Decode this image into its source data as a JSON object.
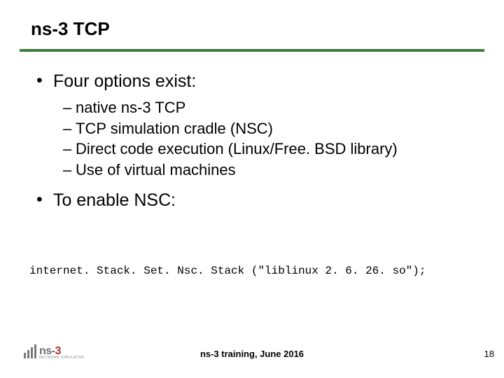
{
  "title": "ns-3 TCP",
  "bullets": [
    {
      "label": "Four options exist:",
      "sub": [
        "native ns-3 TCP",
        "TCP simulation cradle (NSC)",
        "Direct code execution (Linux/Free. BSD library)",
        "Use of virtual machines"
      ]
    },
    {
      "label": "To enable NSC:",
      "sub": []
    }
  ],
  "code": "internet. Stack. Set. Nsc. Stack (\"liblinux 2. 6. 26. so\");",
  "footer": "ns-3 training, June 2016",
  "page": "18",
  "logo": {
    "text_ns": "ns",
    "text_dash": "-",
    "text_three": "3",
    "sub": "NETWORK SIMULATOR"
  }
}
